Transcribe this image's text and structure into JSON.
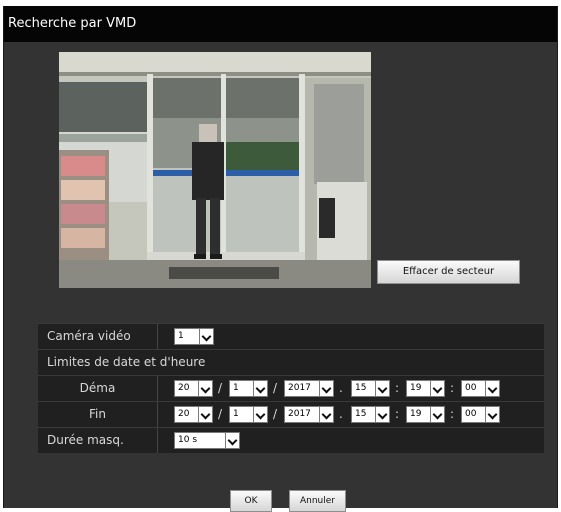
{
  "window": {
    "title": "Recherche par VMD"
  },
  "camera_view": {
    "clear_area_label": "Effacer de secteur"
  },
  "form": {
    "camera": {
      "label": "Caméra vidéo",
      "value": "1"
    },
    "date_limits_label": "Limites de date et d'heure",
    "start": {
      "label": "Déma",
      "day": "20",
      "month": "1",
      "year": "2017",
      "hour": "15",
      "minute": "19",
      "second": "00"
    },
    "end": {
      "label": "Fin",
      "day": "20",
      "month": "1",
      "year": "2017",
      "hour": "15",
      "minute": "19",
      "second": "00"
    },
    "duration": {
      "label": "Durée masq.",
      "value": "10 s"
    }
  },
  "separators": {
    "slash": "/",
    "dot": ".",
    "colon": ":"
  },
  "buttons": {
    "ok": "OK",
    "cancel": "Annuler"
  }
}
